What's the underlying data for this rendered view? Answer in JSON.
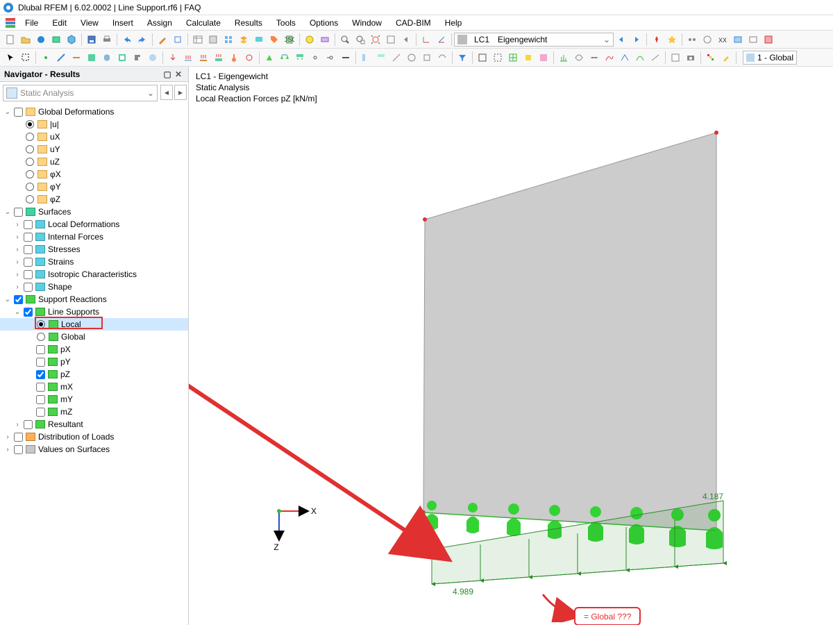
{
  "title": "Dlubal RFEM | 6.02.0002 | Line Support.rf6 | FAQ",
  "menubar": [
    "File",
    "Edit",
    "View",
    "Insert",
    "Assign",
    "Calculate",
    "Results",
    "Tools",
    "Options",
    "Window",
    "CAD-BIM",
    "Help"
  ],
  "toolbar": {
    "loadcase_id": "LC1",
    "loadcase_name": "Eigengewicht",
    "right_combo": "1 - Global"
  },
  "navigator": {
    "title": "Navigator - Results",
    "dropdown": "Static Analysis",
    "tree": {
      "global_deformations": {
        "label": "Global Deformations",
        "checked": false,
        "children": [
          "|u|",
          "uX",
          "uY",
          "uZ",
          "φX",
          "φY",
          "φZ"
        ],
        "selected_radio": 0
      },
      "surfaces": {
        "label": "Surfaces",
        "checked": false,
        "children": [
          {
            "label": "Local Deformations"
          },
          {
            "label": "Internal Forces"
          },
          {
            "label": "Stresses"
          },
          {
            "label": "Strains"
          },
          {
            "label": "Isotropic Characteristics"
          },
          {
            "label": "Shape"
          }
        ]
      },
      "support_reactions": {
        "label": "Support Reactions",
        "checked": true,
        "line_supports": {
          "label": "Line Supports",
          "checked": true,
          "radios": [
            {
              "label": "Local",
              "checked": true
            },
            {
              "label": "Global",
              "checked": false
            }
          ],
          "components": [
            {
              "label": "pX",
              "checked": false
            },
            {
              "label": "pY",
              "checked": false
            },
            {
              "label": "pZ",
              "checked": true
            },
            {
              "label": "mX",
              "checked": false
            },
            {
              "label": "mY",
              "checked": false
            },
            {
              "label": "mZ",
              "checked": false
            }
          ]
        },
        "resultant": {
          "label": "Resultant"
        }
      },
      "distribution_of_loads": {
        "label": "Distribution of Loads",
        "checked": false
      },
      "values_on_surfaces": {
        "label": "Values on Surfaces",
        "checked": false
      }
    }
  },
  "viewport_header": {
    "line1": "LC1 - Eigengewicht",
    "line2": "Static Analysis",
    "line3": "Local Reaction Forces pZ [kN/m]"
  },
  "axis": {
    "x_label": "X",
    "z_label": "Z"
  },
  "result_values": {
    "left": "4.989",
    "right": "4.187"
  },
  "callout": "= Global ???"
}
